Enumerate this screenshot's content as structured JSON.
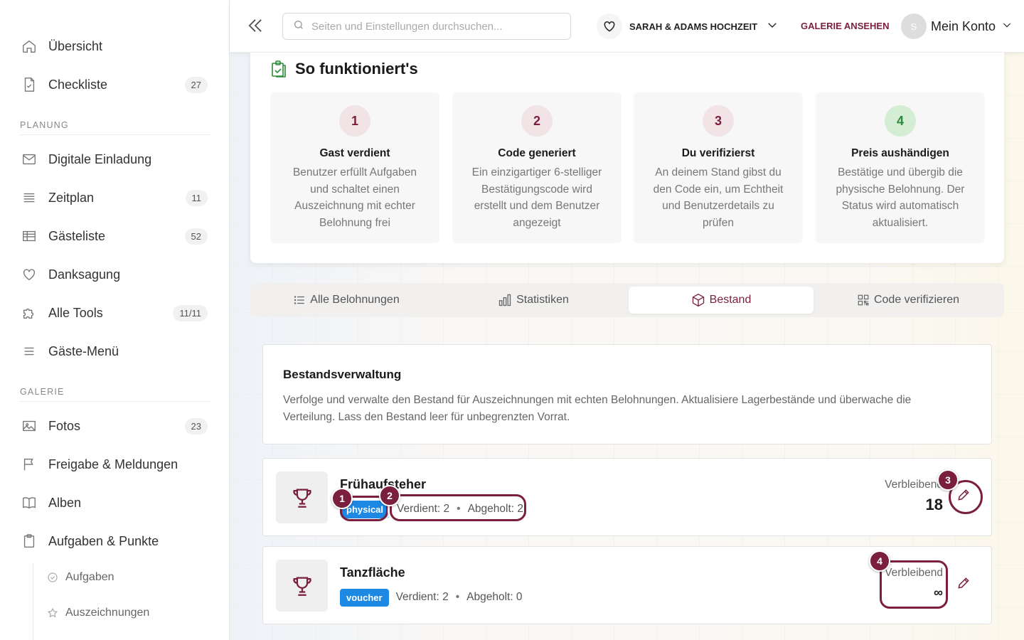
{
  "sidebar": {
    "items_top": [
      {
        "label": "Übersicht",
        "icon": "home-icon",
        "badge": ""
      },
      {
        "label": "Checkliste",
        "icon": "document-check-icon",
        "badge": "27"
      }
    ],
    "section_planning": "PLANUNG",
    "items_planning": [
      {
        "label": "Digitale Einladung",
        "icon": "envelope-icon",
        "badge": ""
      },
      {
        "label": "Zeitplan",
        "icon": "list-icon",
        "badge": "11"
      },
      {
        "label": "Gästeliste",
        "icon": "table-icon",
        "badge": "52"
      },
      {
        "label": "Danksagung",
        "icon": "heart-icon",
        "badge": ""
      },
      {
        "label": "Alle Tools",
        "icon": "puzzle-icon",
        "badge": "11/11"
      },
      {
        "label": "Gäste-Menü",
        "icon": "menu-icon",
        "badge": ""
      }
    ],
    "section_gallery": "GALERIE",
    "items_gallery": [
      {
        "label": "Fotos",
        "icon": "image-icon",
        "badge": "23"
      },
      {
        "label": "Freigabe & Meldungen",
        "icon": "flag-icon",
        "badge": ""
      },
      {
        "label": "Alben",
        "icon": "book-icon",
        "badge": ""
      },
      {
        "label": "Aufgaben & Punkte",
        "icon": "clipboard-icon",
        "badge": ""
      }
    ],
    "sub_items": [
      {
        "label": "Aufgaben",
        "icon": "check-circle-icon"
      },
      {
        "label": "Auszeichnungen",
        "icon": "star-icon"
      }
    ]
  },
  "header": {
    "search_placeholder": "Seiten und Einstellungen durchsuchen...",
    "event_name": "SARAH & ADAMS HOCHZEIT",
    "gallery_link": "GALERIE ANSEHEN",
    "avatar_initial": "S",
    "account_label": "Mein Konto"
  },
  "how": {
    "title": "So funktioniert's",
    "steps": [
      {
        "num": "1",
        "title": "Gast verdient",
        "desc": "Benutzer erfüllt Aufgaben und schaltet einen Auszeichnung mit echter Belohnung frei"
      },
      {
        "num": "2",
        "title": "Code generiert",
        "desc": "Ein einzigartiger 6-stelliger Bestätigungscode wird erstellt und dem Benutzer angezeigt"
      },
      {
        "num": "3",
        "title": "Du verifizierst",
        "desc": "An deinem Stand gibst du den Code ein, um Echtheit und Benutzerdetails zu prüfen"
      },
      {
        "num": "4",
        "title": "Preis aushändigen",
        "desc": "Bestätige und übergib die physische Belohnung. Der Status wird automatisch aktualisiert."
      }
    ]
  },
  "tabs": [
    {
      "label": "Alle Belohnungen",
      "icon": "list-icon"
    },
    {
      "label": "Statistiken",
      "icon": "bar-chart-icon"
    },
    {
      "label": "Bestand",
      "icon": "box-icon"
    },
    {
      "label": "Code verifizieren",
      "icon": "qr-code-icon"
    }
  ],
  "inventory": {
    "title": "Bestandsverwaltung",
    "desc": "Verfolge und verwalte den Bestand für Auszeichnungen mit echten Belohnungen. Aktualisiere Lagerbestände und überwache die Verteilung. Lass den Bestand leer für unbegrenzten Vorrat."
  },
  "rewards": [
    {
      "name": "Frühaufsteher",
      "type": "physical",
      "earned": "Verdient: 2",
      "claimed": "Abgeholt: 2",
      "remaining_label": "Verbleibend",
      "remaining": "18"
    },
    {
      "name": "Tanzfläche",
      "type": "voucher",
      "earned": "Verdient: 2",
      "claimed": "Abgeholt: 0",
      "remaining_label": "Verbleibend",
      "remaining": "∞"
    }
  ],
  "annotations": [
    "1",
    "2",
    "3",
    "4"
  ],
  "colors": {
    "accent": "#7a1f3d",
    "badge_blue": "#1e88e5",
    "step_green": "#2e8b3a"
  }
}
